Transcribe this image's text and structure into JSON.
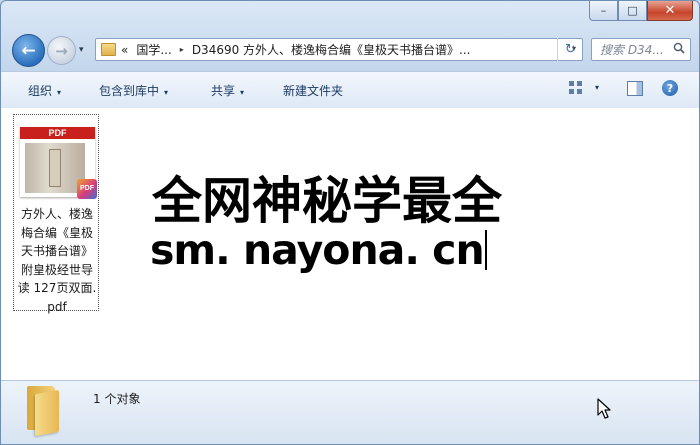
{
  "window": {
    "caption": {
      "minimize": "–",
      "maximize": "□",
      "close": "✕"
    }
  },
  "nav": {
    "back_icon": "←",
    "forward_icon": "→",
    "recent_icon": "▾"
  },
  "address": {
    "overflow": "«",
    "crumbs": [
      "国学...",
      "D34690 方外人、楼逸梅合编《皇极天书播台谱》..."
    ],
    "separator": "▸",
    "dropdown_icon": "▾",
    "refresh_icon": "↻"
  },
  "search": {
    "placeholder": "搜索 D34...",
    "icon": "search-icon"
  },
  "toolbar": {
    "organize": "组织",
    "include_library": "包含到库中",
    "share": "共享",
    "new_folder": "新建文件夹",
    "arrow": "▾",
    "help": "?"
  },
  "files": [
    {
      "thumb_label": "PDF",
      "badge": "PDF",
      "name_lines": [
        "方外人、楼逸",
        "梅合编《皇极",
        "天书播台谱》",
        "附皇极经世导",
        "读 127页双面.",
        "pdf"
      ]
    }
  ],
  "watermark": {
    "line1": "全网神秘学最全",
    "line2": "sm. nayona. cn"
  },
  "status": {
    "count_text": "1 个对象"
  },
  "colors": {
    "close_button": "#c7442c",
    "pdf_band": "#c8201d",
    "toolbar_text": "#1e3b63"
  }
}
